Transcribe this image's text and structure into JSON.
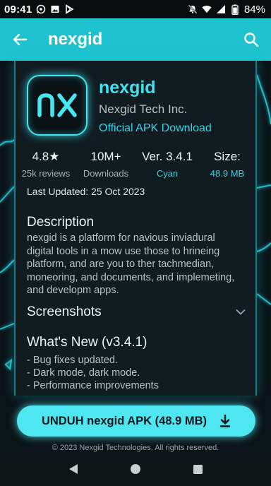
{
  "status_bar": {
    "time": "09:41",
    "battery": "84%"
  },
  "app_bar": {
    "title": "nexgid"
  },
  "app": {
    "logo_text": "nx",
    "name": "nexgid",
    "developer": "Nexgid Tech Inc.",
    "official_link": "Official APK Download"
  },
  "stats": [
    {
      "value": "4.8★",
      "label": "25k reviews"
    },
    {
      "value": "10M+",
      "label": "Downloads"
    },
    {
      "value": "Ver. 3.4.1",
      "label": "Cyan"
    },
    {
      "value": "Size:",
      "label": "48.9 MB"
    }
  ],
  "last_updated": "Last Updated: 25 Oct 2023",
  "description": {
    "title": "Description",
    "lines": [
      "nexgid is a platform for navious inviadural",
      "digital tools in a mow use those to hrineing",
      "platform, and are you to ther tachmedian,",
      "moneoring, and documents, and implemeting,",
      "and developm apps."
    ]
  },
  "screenshots": {
    "title": "Screenshots"
  },
  "whats_new": {
    "title": "What's New (v3.4.1)",
    "items": [
      "- Bug fixes updated.",
      "- Dark mode, dark mode.",
      "- Performance improvements"
    ]
  },
  "download_button": "UNDUH nexgid APK (48.9 MB)",
  "footer": "© 2023 Nexgid Technologies. All rights reserved.",
  "colors": {
    "accent": "#1ec3cf",
    "glow": "#3ee7f2",
    "button": "#4ee6f0",
    "background": "#0b1418",
    "card": "#111c21"
  }
}
